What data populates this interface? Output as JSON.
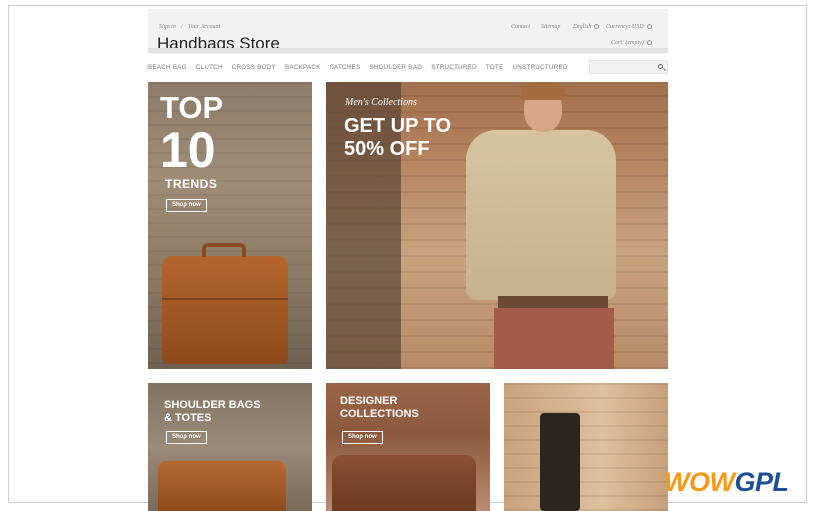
{
  "header": {
    "signin": "Sign in",
    "separator": "/",
    "account": "Your Account",
    "contact": "Contact",
    "sitemap": "Sitemap",
    "language": "English",
    "currency": "Currency: USD",
    "cart": "Cart: (empty)",
    "brand": "Handbags Store"
  },
  "nav": {
    "items": [
      "BEACH BAG",
      "CLUTCH",
      "CROSS BODY",
      "BACKPACK",
      "SATCHES",
      "SHOULDER BAG",
      "STRUCTURED",
      "TOTE",
      "UNSTRUCTURED"
    ]
  },
  "banners": {
    "top": {
      "line1": "TOP",
      "line2": "10",
      "line3": "TRENDS",
      "cta": "Shop now"
    },
    "men": {
      "subtitle": "Men's Collections",
      "headline1": "GET UP TO",
      "headline2": "50% OFF"
    },
    "shoulder": {
      "line1": "SHOULDER BAGS",
      "line2": "& TOTES",
      "cta": "Shop now"
    },
    "designer": {
      "line1": "DESIGNER",
      "line2": "COLLECTIONS",
      "cta": "Shop now"
    }
  },
  "watermark": {
    "part1": "WOW",
    "part2": "GPL"
  }
}
